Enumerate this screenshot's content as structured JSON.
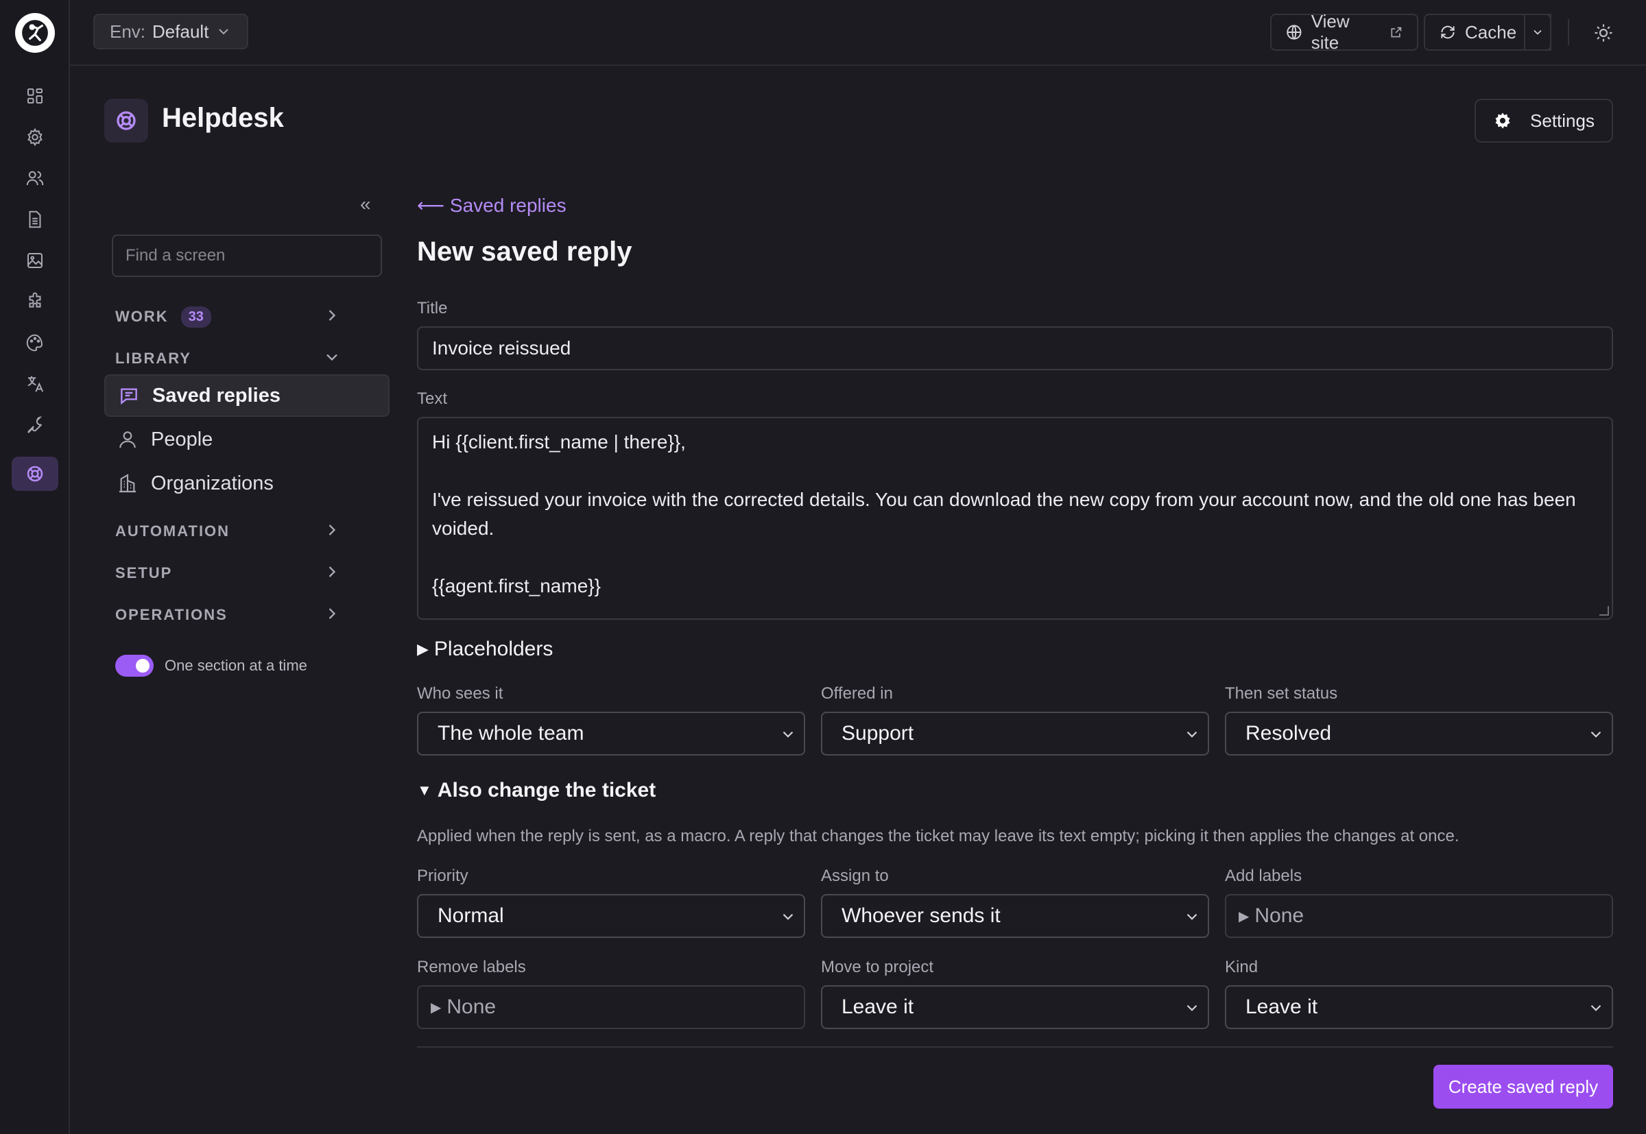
{
  "topbar": {
    "env_key": "Env:",
    "env_value": "Default",
    "view_site": "View site",
    "cache": "Cache"
  },
  "app": {
    "title": "Helpdesk",
    "settings_label": "Settings"
  },
  "sidebar": {
    "search_placeholder": "Find a screen",
    "sections": {
      "work": {
        "label": "WORK",
        "badge": "33"
      },
      "library": {
        "label": "LIBRARY"
      },
      "automation": {
        "label": "AUTOMATION"
      },
      "setup": {
        "label": "SETUP"
      },
      "operations": {
        "label": "OPERATIONS"
      }
    },
    "items": [
      {
        "label": "Saved replies",
        "icon": "message-icon",
        "active": true
      },
      {
        "label": "People",
        "icon": "person-icon",
        "active": false
      },
      {
        "label": "Organizations",
        "icon": "building-icon",
        "active": false
      }
    ],
    "toggle_label": "One section at a time"
  },
  "form": {
    "back_link": "⟵ Saved replies",
    "title": "New saved reply",
    "title_label": "Title",
    "title_value": "Invoice reissued",
    "text_label": "Text",
    "text_lines": [
      "Hi {{client.first_name | there}},",
      "",
      "I've reissued your invoice with the corrected details. You can download the new copy from your account now, and the old one has been voided.",
      "",
      "{{agent.first_name}}"
    ],
    "placeholders_label": "Placeholders",
    "who_sees_label": "Who sees it",
    "who_sees_value": "The whole team",
    "offered_in_label": "Offered in",
    "offered_in_value": "Support",
    "status_label": "Then set status",
    "status_value": "Resolved",
    "also_change_label": "Also change the ticket",
    "also_change_help": "Applied when the reply is sent, as a macro. A reply that changes the ticket may leave its text empty; picking it then applies the changes at once.",
    "priority_label": "Priority",
    "priority_value": "Normal",
    "assign_label": "Assign to",
    "assign_value": "Whoever sends it",
    "add_labels_label": "Add labels",
    "add_labels_value": "None",
    "remove_labels_label": "Remove labels",
    "remove_labels_value": "None",
    "move_project_label": "Move to project",
    "move_project_value": "Leave it",
    "kind_label": "Kind",
    "kind_value": "Leave it",
    "submit_label": "Create saved reply"
  },
  "colors": {
    "accent": "#9b5cf6",
    "background": "#1c1b21"
  }
}
